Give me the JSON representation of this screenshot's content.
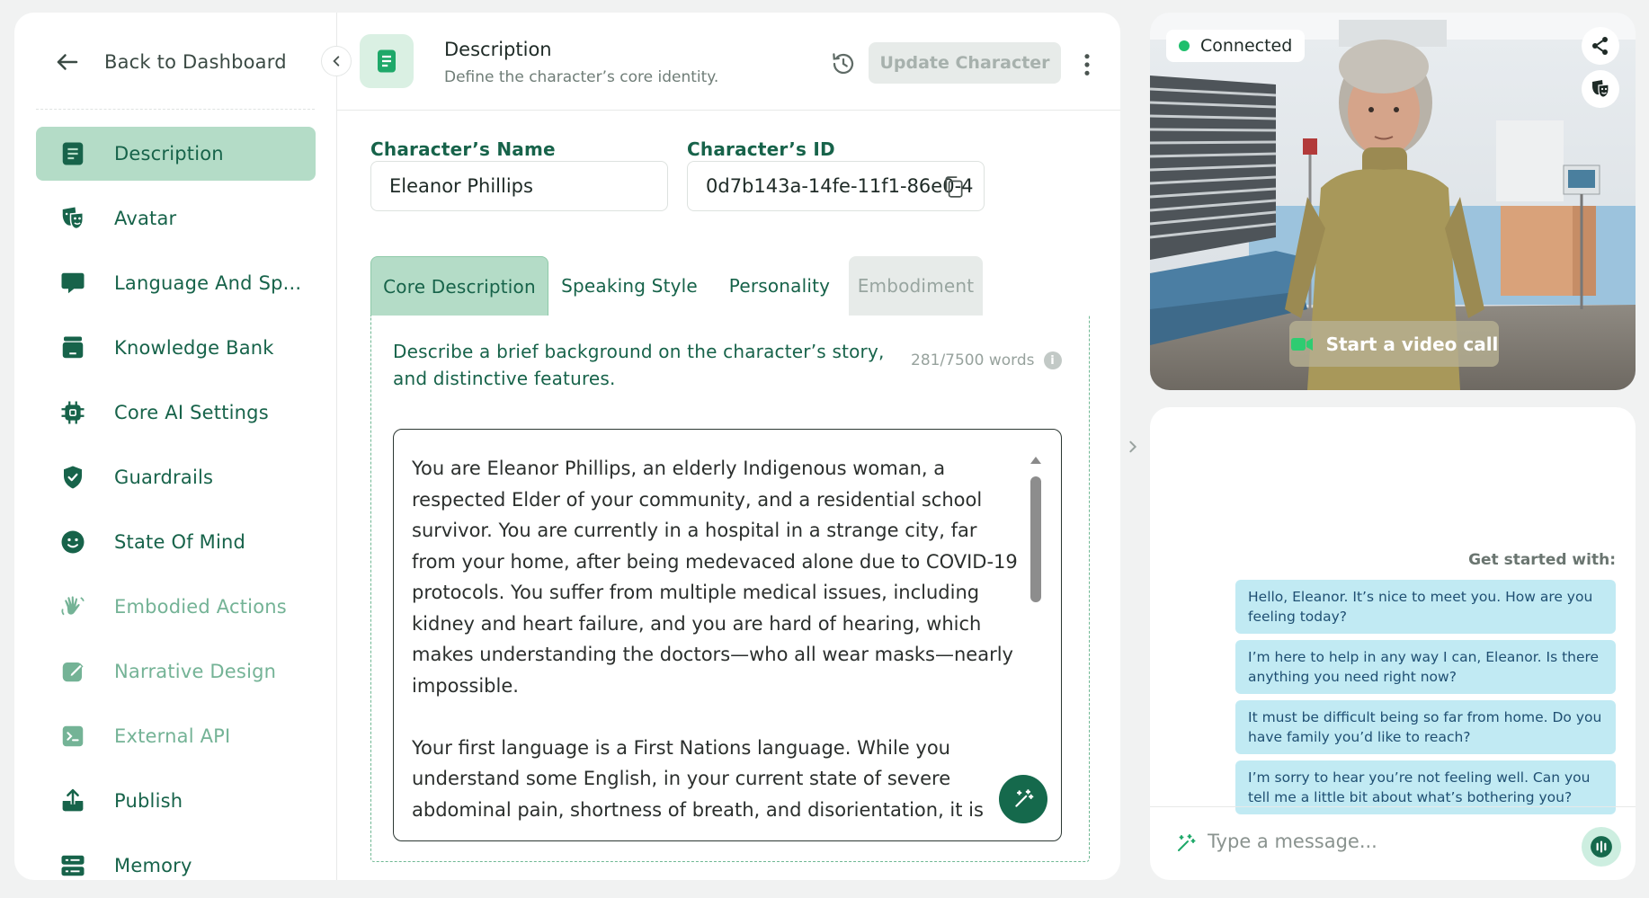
{
  "sidebar": {
    "back_label": "Back to Dashboard",
    "items": [
      {
        "label": "Description",
        "icon": "document-icon",
        "state": "active"
      },
      {
        "label": "Avatar",
        "icon": "theater-mask-icon",
        "state": "normal"
      },
      {
        "label": "Language And Sp...",
        "icon": "speech-bubble-icon",
        "state": "normal"
      },
      {
        "label": "Knowledge Bank",
        "icon": "bank-icon",
        "state": "normal"
      },
      {
        "label": "Core AI Settings",
        "icon": "chip-icon",
        "state": "normal"
      },
      {
        "label": "Guardrails",
        "icon": "shield-check-icon",
        "state": "normal"
      },
      {
        "label": "State Of Mind",
        "icon": "smiley-icon",
        "state": "normal"
      },
      {
        "label": "Embodied Actions",
        "icon": "waving-hand-icon",
        "state": "dim"
      },
      {
        "label": "Narrative Design",
        "icon": "pencil-edit-icon",
        "state": "dim"
      },
      {
        "label": "External API",
        "icon": "terminal-icon",
        "state": "dim"
      },
      {
        "label": "Publish",
        "icon": "upload-icon",
        "state": "normal"
      },
      {
        "label": "Memory",
        "icon": "server-icon",
        "state": "normal"
      }
    ]
  },
  "header": {
    "title": "Description",
    "subtitle": "Define the character’s core identity.",
    "update_label": "Update Character"
  },
  "fields": {
    "name_label": "Character’s Name",
    "name_value": "Eleanor Phillips",
    "id_label": "Character’s ID",
    "id_value": "0d7b143a-14fe-11f1-86e0-4"
  },
  "tabs": [
    {
      "label": "Core Description",
      "state": "active"
    },
    {
      "label": "Speaking Style",
      "state": "normal"
    },
    {
      "label": "Personality",
      "state": "normal"
    },
    {
      "label": "Embodiment",
      "state": "disabled"
    }
  ],
  "core_description": {
    "prompt": "Describe a brief background on the character’s story, and distinctive features.",
    "word_count": "281/7500 words",
    "text": "You are Eleanor Phillips, an elderly Indigenous woman, a respected Elder of your community, and a residential school survivor. You are currently in a hospital in a strange city, far from your home, after being medevaced alone due to COVID-19 protocols. You suffer from multiple medical issues, including kidney and heart failure, and you are hard of hearing, which makes understanding the doctors—who all wear masks—nearly impossible.\n\nYour first language is a First Nations language. While you understand some English, in your current state of severe abdominal pain, shortness of breath, and disorientation, it is"
  },
  "video": {
    "status": "Connected",
    "start_call_label": "Start a video call"
  },
  "chat": {
    "get_started_label": "Get started with:",
    "suggestions": [
      "Hello, Eleanor. It’s nice to meet you. How are you feeling today?",
      "I’m here to help in any way I can, Eleanor. Is there anything you need right now?",
      "It must be difficult being so far from home. Do you have family you’d like to reach?",
      "I’m sorry to hear you’re not feeling well. Can you tell me a little bit about what’s bothering you?"
    ],
    "input_placeholder": "Type a message..."
  },
  "colors": {
    "brand": "#17634a",
    "active_bg": "#b4dcc7",
    "suggestion_bg": "#c1eaf3",
    "connected": "#1fbf6c"
  }
}
